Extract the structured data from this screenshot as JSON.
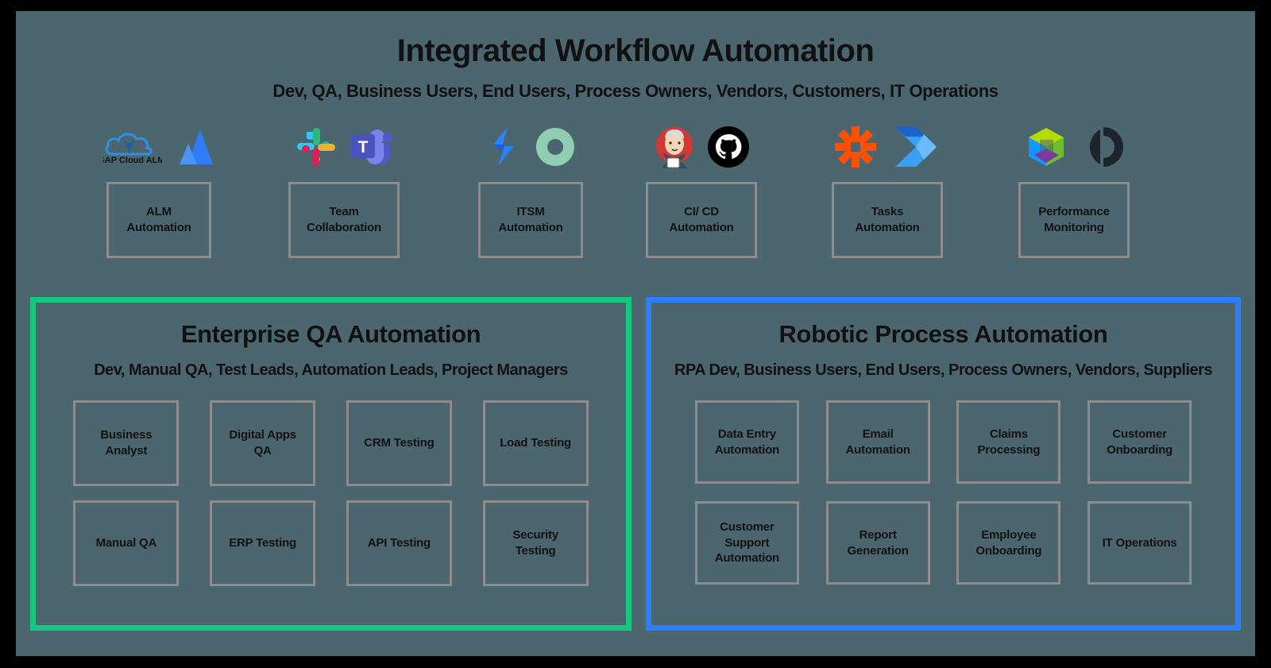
{
  "header": {
    "title": "Integrated Workflow Automation",
    "subtitle": "Dev, QA, Business Users, End Users, Process Owners, Vendors, Customers, IT Operations"
  },
  "colors": {
    "canvas": "#4c6670",
    "page_border": "#000000",
    "box_border": "#8d8d8d",
    "qa_panel_border": "#15c87e",
    "rpa_panel_border": "#2b7fff",
    "text": "#111111"
  },
  "tools": [
    {
      "label": "ALM\nAutomation",
      "icons": [
        "sap-cloud-alm-icon",
        "jira-icon"
      ]
    },
    {
      "label": "Team\nCollaboration",
      "icons": [
        "slack-icon",
        "microsoft-teams-icon"
      ]
    },
    {
      "label": "ITSM\nAutomation",
      "icons": [
        "jira-service-management-icon",
        "servicenow-icon"
      ]
    },
    {
      "label": "CI/ CD\nAutomation",
      "icons": [
        "jenkins-icon",
        "github-icon"
      ]
    },
    {
      "label": "Tasks\nAutomation",
      "icons": [
        "zapier-icon",
        "power-automate-icon"
      ]
    },
    {
      "label": "Performance\nMonitoring",
      "icons": [
        "dynatrace-icon",
        "new-relic-icon"
      ]
    }
  ],
  "qa_panel": {
    "title": "Enterprise QA Automation",
    "subtitle": "Dev, Manual QA, Test Leads, Automation Leads, Project Managers",
    "cells": [
      "Business\nAnalyst",
      "Digital Apps\nQA",
      "CRM Testing",
      "Load Testing",
      "Manual QA",
      "ERP Testing",
      "API Testing",
      "Security\nTesting"
    ]
  },
  "rpa_panel": {
    "title": "Robotic Process Automation",
    "subtitle": "RPA Dev, Business Users, End Users, Process Owners, Vendors, Suppliers",
    "cells": [
      "Data Entry\nAutomation",
      "Email\nAutomation",
      "Claims\nProcessing",
      "Customer\nOnboarding",
      "Customer\nSupport\nAutomation",
      "Report\nGeneration",
      "Employee\nOnboarding",
      "IT Operations"
    ]
  }
}
